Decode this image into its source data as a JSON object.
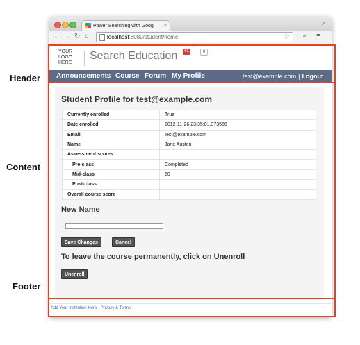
{
  "annotations": {
    "header_label": "Header",
    "content_label": "Content",
    "footer_label": "Footer"
  },
  "browser": {
    "tab_title": "Power Searching with Googl",
    "tab_close": "×",
    "url_host": "localhost",
    "url_path": ":8080/student/home",
    "icons": [
      "back-arrow-icon",
      "forward-arrow-icon",
      "reload-icon",
      "home-icon",
      "page-icon",
      "star-icon",
      "extension-icon",
      "menu-icon"
    ]
  },
  "site": {
    "logo_line1": "YOUR",
    "logo_line2": "LOGO",
    "logo_line3": "HERE",
    "title": "Search Education",
    "gplus_label": "+1",
    "gplus_count": "0",
    "nav": {
      "announcements": "Announcements",
      "course": "Course",
      "forum": "Forum",
      "profile": "My Profile",
      "email": "test@example.com",
      "separator": "|",
      "logout": "Logout"
    }
  },
  "profile": {
    "heading": "Student Profile for test@example.com",
    "rows": [
      {
        "key": "Currently enrolled",
        "value": "True"
      },
      {
        "key": "Date enrolled",
        "value": "2012-11-26 23:35:01.373556"
      },
      {
        "key": "Email",
        "value": "test@example.com"
      },
      {
        "key": "Name",
        "value": "Jane Austen"
      },
      {
        "key": "Assessment scores",
        "value": ""
      },
      {
        "key": "Pre-class",
        "value": "Completed"
      },
      {
        "key": "Mid-class",
        "value": "60"
      },
      {
        "key": "Post-class",
        "value": ""
      },
      {
        "key": "Overall course score",
        "value": ""
      }
    ]
  },
  "new_name": {
    "heading": "New Name",
    "input_value": "",
    "save_label": "Save Changes",
    "cancel_label": "Cancel"
  },
  "unenroll": {
    "heading": "To leave the course permanently, click on Unenroll",
    "button_label": "Unenroll"
  },
  "footer": {
    "text": "Add Your Institution Here  -  Privacy & Terms"
  },
  "colors": {
    "navbar": "#5d6b86",
    "annotation_red": "#e8411e",
    "button": "#555555"
  }
}
